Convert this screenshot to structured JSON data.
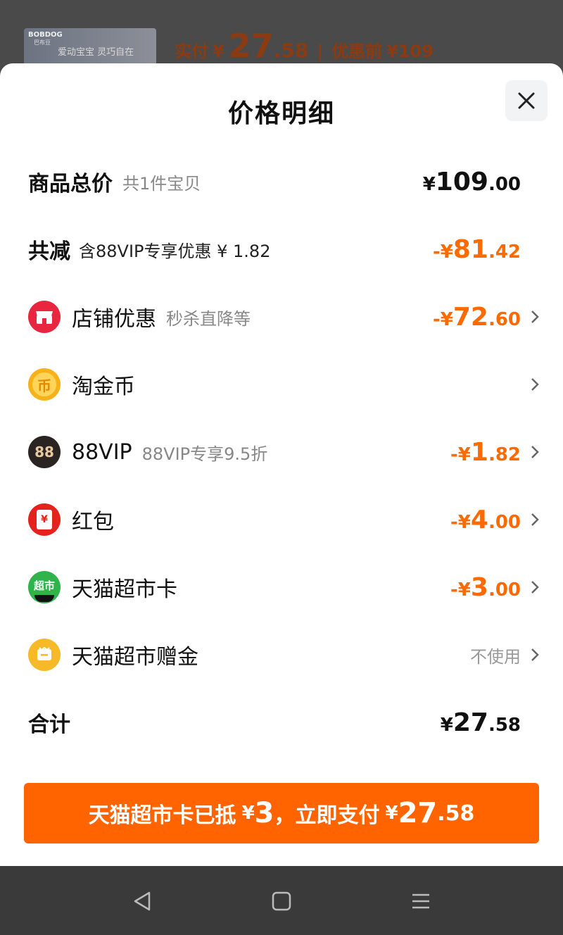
{
  "background": {
    "product_brand": "BOBDOG",
    "product_brand_sub": "巴布豆",
    "product_slogan": "爱动宝宝 灵巧自在",
    "price_label": "实付",
    "currency": "¥",
    "price_int": "27",
    "price_dec": ".58",
    "original_label": "优惠前",
    "original_price": "¥109"
  },
  "sheet": {
    "title": "价格明细",
    "close_icon": "close-icon"
  },
  "total": {
    "label": "商品总价",
    "sub": "共1件宝贝",
    "sym": "¥",
    "int": "109",
    "dec": ".00"
  },
  "discount": {
    "label": "共减",
    "sub": "含88VIP专享优惠 ¥ 1.82",
    "sym": "-¥",
    "int": "81",
    "dec": ".42"
  },
  "items": [
    {
      "icon": "store-icon",
      "label": "店铺优惠",
      "sub": "秒杀直降等",
      "sym": "-¥",
      "int": "72",
      "dec": ".60",
      "color": "#e8263f"
    },
    {
      "icon": "coin-icon",
      "label": "淘金币",
      "sub": "",
      "sym": "",
      "int": "",
      "dec": "",
      "color": "#f7b21a"
    },
    {
      "icon": "vip-icon",
      "label": "88VIP",
      "sub": "88VIP专享9.5折",
      "sym": "-¥",
      "int": "1",
      "dec": ".82",
      "color": "#2a2522"
    },
    {
      "icon": "red-envelope-icon",
      "label": "红包",
      "sub": "",
      "sym": "-¥",
      "int": "4",
      "dec": ".00",
      "color": "#e5231d"
    },
    {
      "icon": "supermarket-card-icon",
      "label": "天猫超市卡",
      "sub": "",
      "sym": "-¥",
      "int": "3",
      "dec": ".00",
      "color": "#2fb34a"
    },
    {
      "icon": "gift-money-icon",
      "label": "天猫超市赠金",
      "sub": "",
      "status": "不使用",
      "color": "#f6b928"
    }
  ],
  "icon_text": {
    "vip": "88",
    "hongbao": "¥",
    "coin": "币",
    "supermarket": "超市"
  },
  "sum": {
    "label": "合计",
    "sym": "¥",
    "int": "27",
    "dec": ".58"
  },
  "pay_button": {
    "text_a": "天猫超市卡已抵",
    "sym_a": "¥",
    "amount_a": "3",
    "text_b": "，立即支付",
    "sym_b": "¥",
    "amount_b_int": "27",
    "amount_b_dec": ".58",
    "color": "#ff6400"
  },
  "navbar": {
    "back": "back-icon",
    "home": "home-icon",
    "menu": "menu-icon"
  }
}
